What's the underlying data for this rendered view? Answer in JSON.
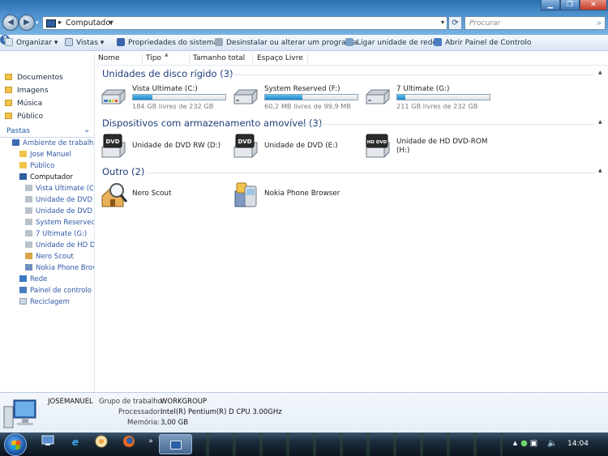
{
  "address": {
    "crumb": "Computador",
    "search_placeholder": "Procurar"
  },
  "window_buttons": {
    "minimize": "▁",
    "maximize": "❐",
    "close": "✕"
  },
  "toolbar": {
    "organize": "Organizar ▾",
    "views": "Vistas ▾",
    "system_props": "Propriedades do sistema",
    "uninstall": "Desinstalar ou alterar um programa",
    "map_drive": "Ligar unidade de rede",
    "control_panel": "Abrir Painel de Controlo",
    "help": "?"
  },
  "favorites": [
    {
      "label": "Documentos"
    },
    {
      "label": "Imagens"
    },
    {
      "label": "Música"
    },
    {
      "label": "Público"
    }
  ],
  "folders": {
    "header": "Pastas",
    "items": [
      {
        "label": "Ambiente de trabalho"
      },
      {
        "label": "Jose Manuel"
      },
      {
        "label": "Público"
      },
      {
        "label": "Computador"
      },
      {
        "label": "Vista Ultimate (C:)"
      },
      {
        "label": "Unidade de DVD R"
      },
      {
        "label": "Unidade de DVD ("
      },
      {
        "label": "System Reserved ("
      },
      {
        "label": "7 Ultimate (G:)"
      },
      {
        "label": "Unidade de HD DV"
      },
      {
        "label": "Nero Scout"
      },
      {
        "label": "Nokia Phone Brov"
      },
      {
        "label": "Rede"
      },
      {
        "label": "Painel de controlo"
      },
      {
        "label": "Reciclagem"
      }
    ]
  },
  "columns": [
    "Nome",
    "Tipo",
    "Tamanho total",
    "Espaço Livre"
  ],
  "groups": {
    "hdd": "Unidades de disco rígido (3)",
    "removable": "Dispositivos com armazenamento amovível (3)",
    "other": "Outro (2)"
  },
  "drives": [
    {
      "name": "Vista Ultimate (C:)",
      "free": "184 GB livres de 232 GB",
      "used_fraction": 0.21
    },
    {
      "name": "System Reserved (F:)",
      "free": "60,2 MB livres de 99,9 MB",
      "used_fraction": 0.4
    },
    {
      "name": "7 Ultimate (G:)",
      "free": "211 GB livres de 232 GB",
      "used_fraction": 0.09
    }
  ],
  "removable": [
    {
      "name": "Unidade de DVD RW (D:)",
      "badge": "DVD"
    },
    {
      "name": "Unidade de DVD (E:)",
      "badge": "DVD"
    },
    {
      "name": "Unidade de HD DVD-ROM",
      "name2": "(H:)",
      "badge": "HD DVD"
    }
  ],
  "other_items": [
    {
      "name": "Nero Scout"
    },
    {
      "name": "Nokia Phone Browser"
    }
  ],
  "details": {
    "computer_name": "JOSEMANUEL",
    "workgroup_label": "Grupo de trabalho:",
    "workgroup_value": "WORKGROUP",
    "processor_label": "Processador:",
    "processor_value": "Intel(R) Pentium(R) D CPU 3.00GHz",
    "memory_label": "Memória:",
    "memory_value": "3,00 GB"
  },
  "taskbar": {
    "more": "»",
    "clock": "14:04"
  },
  "colors": {
    "group_header": "#1e3d79",
    "tree_link": "#2f57a6",
    "bar_fill": "#1c86c9"
  }
}
